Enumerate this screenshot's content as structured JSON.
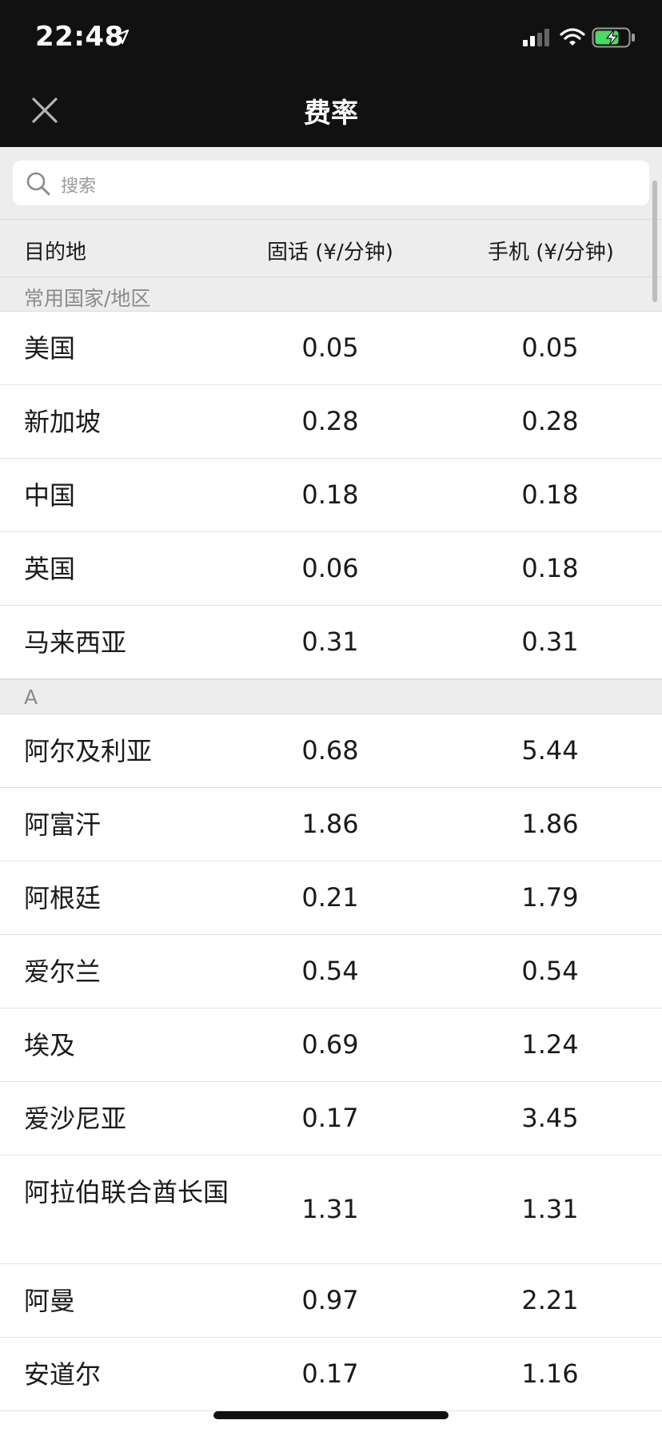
{
  "status_bar": {
    "time": "22:48",
    "icons": [
      "location-arrow-icon",
      "cellular-signal-icon",
      "wifi-icon",
      "battery-charging-icon"
    ],
    "battery_color": "#4cd964"
  },
  "nav": {
    "title": "费率",
    "close_icon": "close-icon"
  },
  "search": {
    "placeholder": "搜索"
  },
  "table": {
    "columns": [
      "目的地",
      "固话 (¥/分钟)",
      "手机 (¥/分钟)"
    ]
  },
  "sections": [
    {
      "title": "常用国家/地区",
      "rows": [
        {
          "dest": "美国",
          "landline": "0.05",
          "mobile": "0.05"
        },
        {
          "dest": "新加坡",
          "landline": "0.28",
          "mobile": "0.28"
        },
        {
          "dest": "中国",
          "landline": "0.18",
          "mobile": "0.18"
        },
        {
          "dest": "英国",
          "landline": "0.06",
          "mobile": "0.18"
        },
        {
          "dest": "马来西亚",
          "landline": "0.31",
          "mobile": "0.31"
        }
      ]
    },
    {
      "title": "A",
      "rows": [
        {
          "dest": "阿尔及利亚",
          "landline": "0.68",
          "mobile": "5.44"
        },
        {
          "dest": "阿富汗",
          "landline": "1.86",
          "mobile": "1.86"
        },
        {
          "dest": "阿根廷",
          "landline": "0.21",
          "mobile": "1.79"
        },
        {
          "dest": "爱尔兰",
          "landline": "0.54",
          "mobile": "0.54"
        },
        {
          "dest": "埃及",
          "landline": "0.69",
          "mobile": "1.24"
        },
        {
          "dest": "爱沙尼亚",
          "landline": "0.17",
          "mobile": "3.45"
        },
        {
          "dest": "阿拉伯联合酋长国",
          "landline": "1.31",
          "mobile": "1.31"
        },
        {
          "dest": "阿曼",
          "landline": "0.97",
          "mobile": "2.21"
        },
        {
          "dest": "安道尔",
          "landline": "0.17",
          "mobile": "1.16"
        }
      ]
    }
  ]
}
